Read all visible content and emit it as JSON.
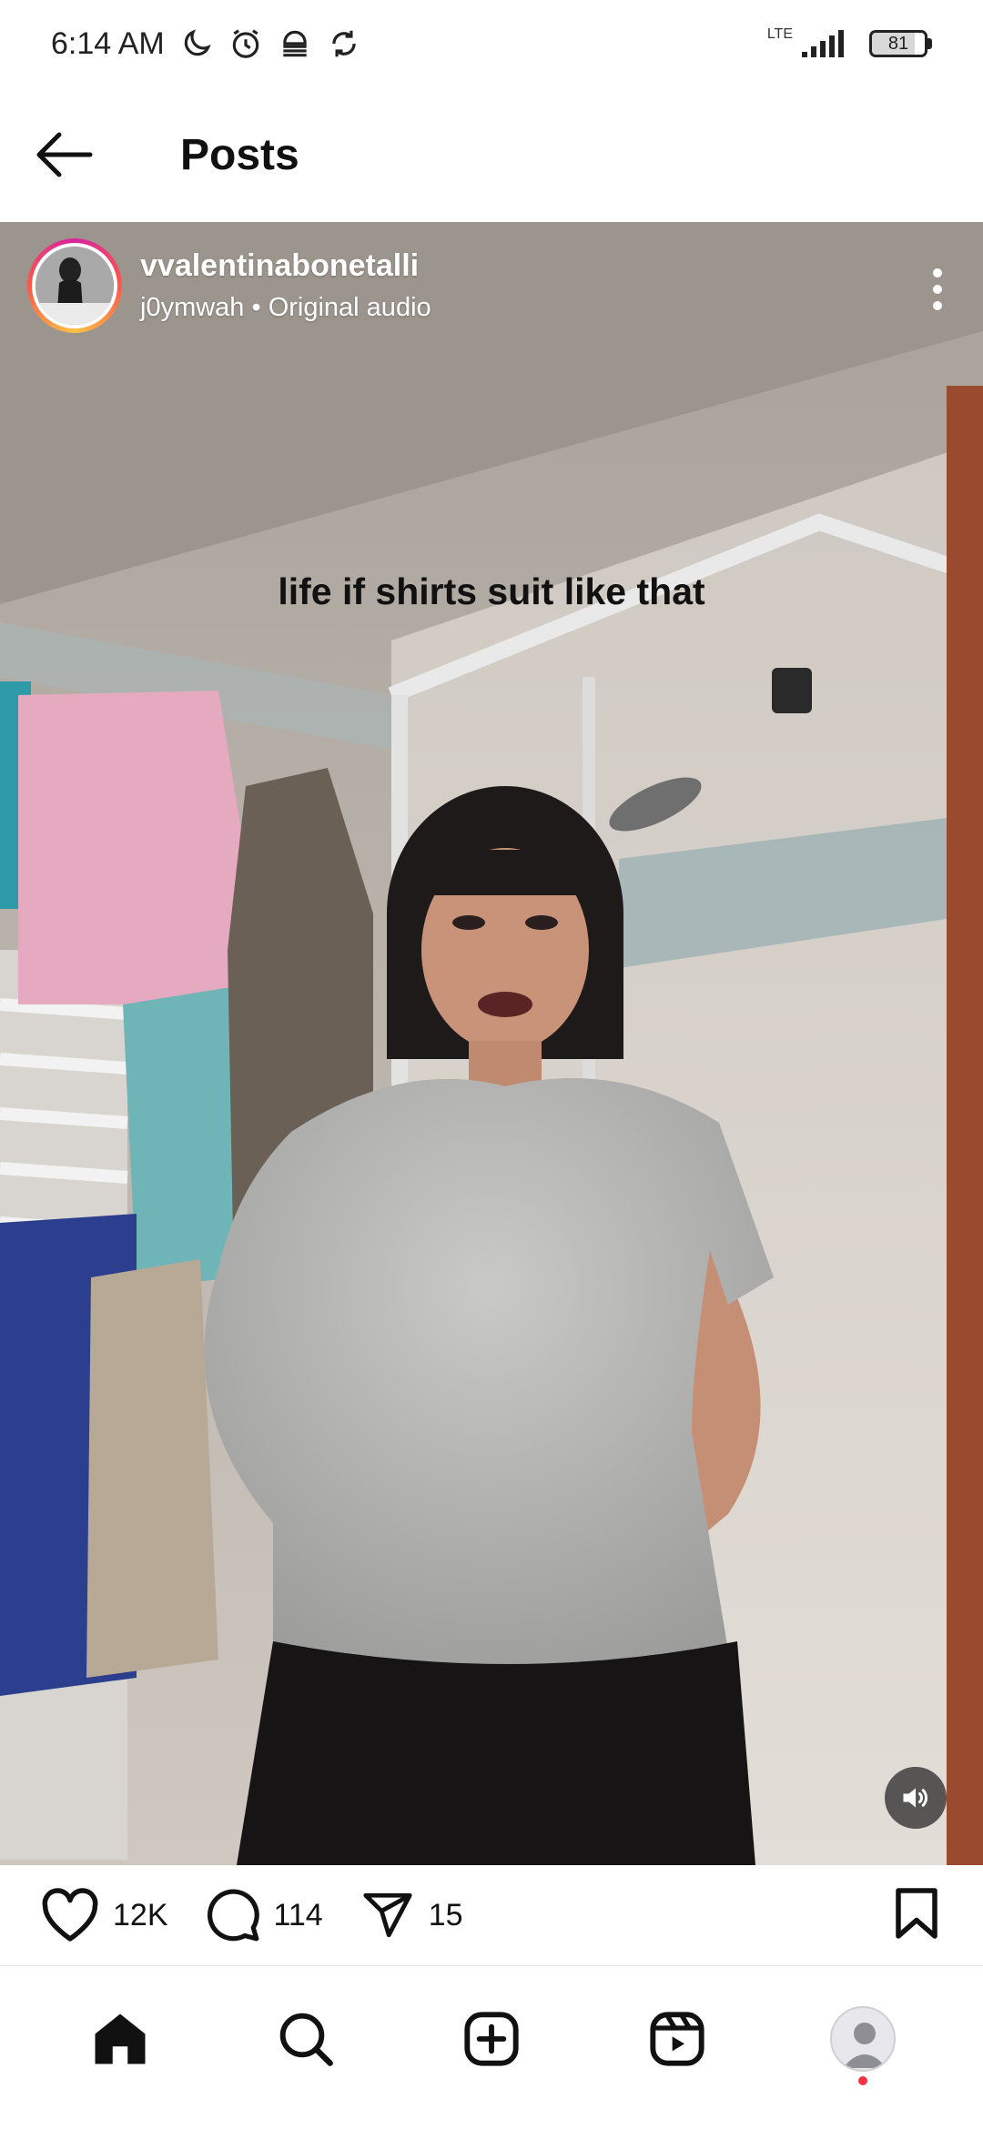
{
  "status_bar": {
    "time": "6:14 AM",
    "network": "LTE",
    "battery": "81",
    "battery_level": 0.81,
    "icons": [
      "moon-icon",
      "alarm-icon",
      "vpn-icon",
      "sync-icon",
      "signal-icon",
      "battery-icon"
    ]
  },
  "header": {
    "title": "Posts",
    "back_icon": "arrow-left-icon"
  },
  "post": {
    "username": "vvalentinabonetalli",
    "audio_info": "j0ymwah • Original audio",
    "caption_overlay": "life if shirts suit like that",
    "volume_icon": "volume-on-icon",
    "more_icon": "more-vertical-icon",
    "actions": {
      "likes": "12K",
      "comments": "114",
      "shares": "15"
    }
  },
  "bottom_nav": {
    "items": [
      "home-icon",
      "search-icon",
      "create-icon",
      "reels-icon",
      "profile-avatar"
    ]
  },
  "colors": {
    "story_ring_start": "#d6249f",
    "story_ring_end": "#fdc147",
    "notification_dot": "#ff3040"
  }
}
